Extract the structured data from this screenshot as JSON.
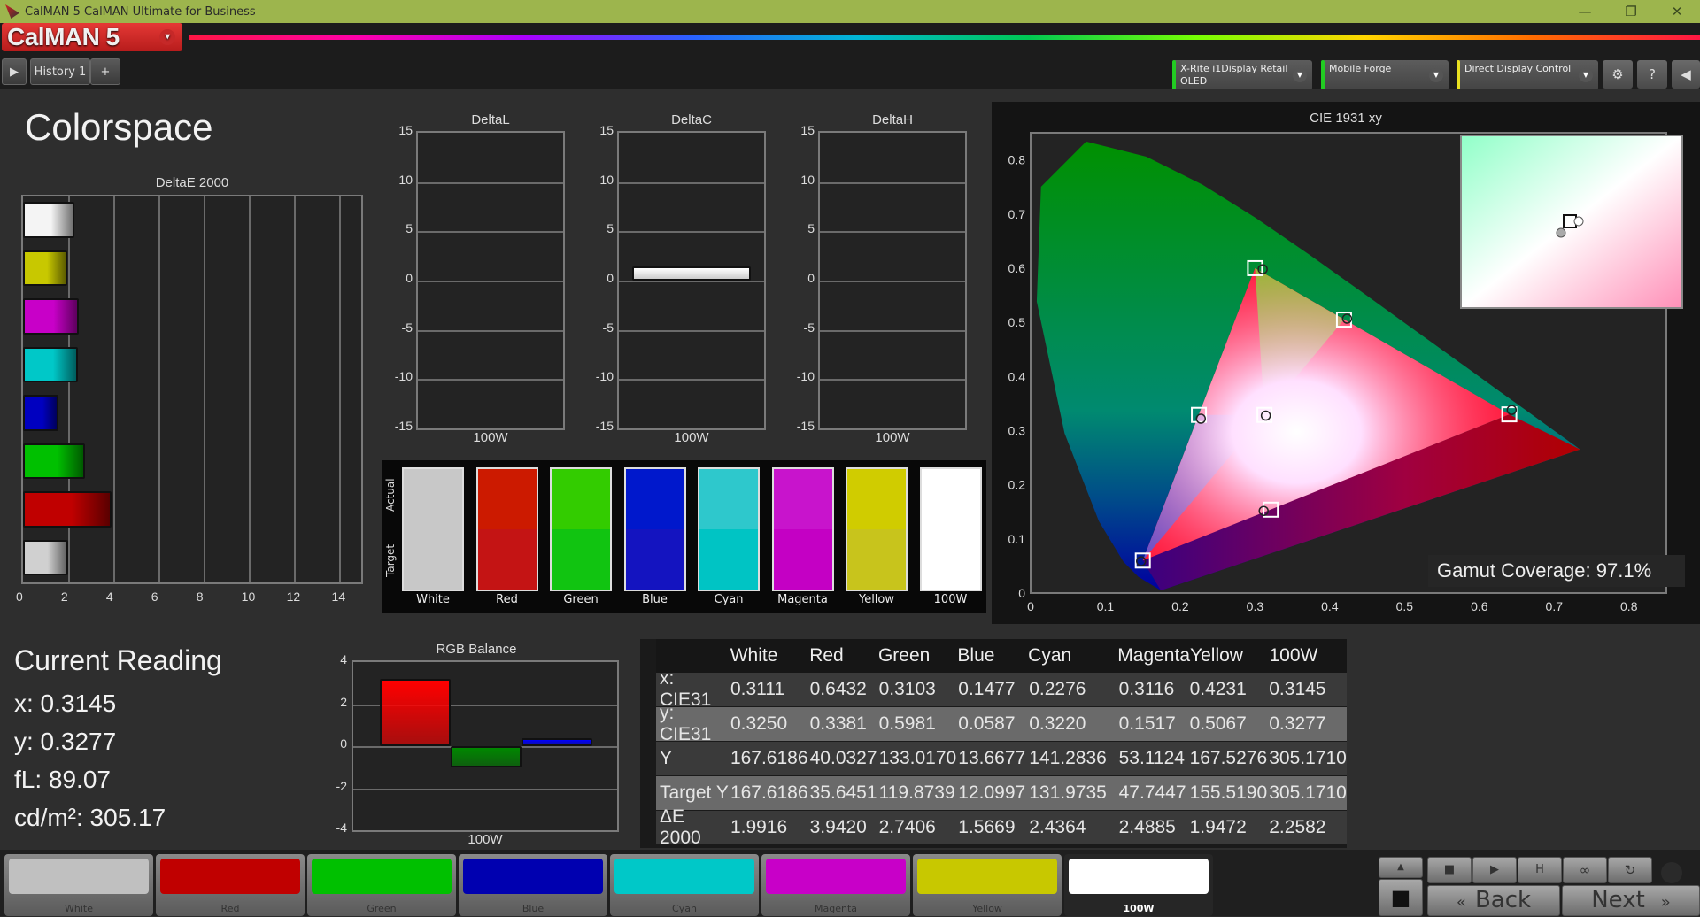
{
  "window": {
    "title": "CalMAN 5 CalMAN Ultimate for Business",
    "minimize": "—",
    "restore": "❐",
    "close": "✕"
  },
  "brand": {
    "name": "CalMAN 5",
    "dropdown": "▾"
  },
  "toolbar": {
    "play_icon": "▶",
    "history_tab": "History 1",
    "add_tab": "+",
    "devices": [
      {
        "line1": "X-Rite i1Display Retail",
        "line2": "OLED",
        "accent": "#22cc22"
      },
      {
        "line1": "Mobile Forge",
        "line2": "",
        "accent": "#22cc22"
      },
      {
        "line1": "Direct Display Control",
        "line2": "",
        "accent": "#e8e020"
      }
    ],
    "settings_icon": "⚙",
    "help_icon": "?",
    "collapse_icon": "◀"
  },
  "page": {
    "title": "Colorspace"
  },
  "deltaE_chart": {
    "title": "DeltaE 2000",
    "xlim": [
      0,
      15
    ],
    "ticks": [
      "0",
      "2",
      "4",
      "6",
      "8",
      "10",
      "12",
      "14"
    ],
    "bars": [
      {
        "name": "100W",
        "value": 2.2582,
        "color": "#f4f4f4"
      },
      {
        "name": "Yellow",
        "value": 1.9472,
        "color": "#c8c800"
      },
      {
        "name": "Magenta",
        "value": 2.4885,
        "color": "#c800c8"
      },
      {
        "name": "Cyan",
        "value": 2.4364,
        "color": "#00c8c8"
      },
      {
        "name": "Blue",
        "value": 1.5669,
        "color": "#0000c0"
      },
      {
        "name": "Green",
        "value": 2.7406,
        "color": "#00c000"
      },
      {
        "name": "Red",
        "value": 3.942,
        "color": "#c00000"
      },
      {
        "name": "White",
        "value": 1.9916,
        "color": "#d0d0d0"
      }
    ]
  },
  "delta_charts": [
    {
      "title": "DeltaL",
      "category": "100W",
      "value": 0,
      "ticks": [
        "15",
        "10",
        "5",
        "0",
        "-5",
        "-10",
        "-15"
      ]
    },
    {
      "title": "DeltaC",
      "category": "100W",
      "value": 1.4,
      "ticks": [
        "15",
        "10",
        "5",
        "0",
        "-5",
        "-10",
        "-15"
      ]
    },
    {
      "title": "DeltaH",
      "category": "100W",
      "value": 0,
      "ticks": [
        "15",
        "10",
        "5",
        "0",
        "-5",
        "-10",
        "-15"
      ]
    }
  ],
  "swatches": {
    "actual_label": "Actual",
    "target_label": "Target",
    "items": [
      {
        "name": "White",
        "actual": "#c8c8c8",
        "target": "#c8c8c8"
      },
      {
        "name": "Red",
        "actual": "#cc1a00",
        "target": "#c41414"
      },
      {
        "name": "Green",
        "actual": "#33cc00",
        "target": "#11c411"
      },
      {
        "name": "Blue",
        "actual": "#0018cc",
        "target": "#1414c0"
      },
      {
        "name": "Cyan",
        "actual": "#2ec8cc",
        "target": "#00c4c4"
      },
      {
        "name": "Magenta",
        "actual": "#c814cc",
        "target": "#c400c4"
      },
      {
        "name": "Yellow",
        "actual": "#d0cc00",
        "target": "#c8c41c"
      },
      {
        "name": "100W",
        "actual": "#ffffff",
        "target": "#ffffff"
      }
    ]
  },
  "cie": {
    "title": "CIE 1931 xy",
    "gamut_label": "Gamut Coverage:",
    "gamut_value": "97.1%",
    "x_ticks": [
      "0",
      "0.1",
      "0.2",
      "0.3",
      "0.4",
      "0.5",
      "0.6",
      "0.7",
      "0.8"
    ],
    "y_ticks": [
      "0",
      "0.1",
      "0.2",
      "0.3",
      "0.4",
      "0.5",
      "0.6",
      "0.7",
      "0.8"
    ],
    "targets": [
      [
        0.64,
        0.33
      ],
      [
        0.3,
        0.6
      ],
      [
        0.15,
        0.06
      ],
      [
        0.3127,
        0.329
      ],
      [
        0.225,
        0.329
      ],
      [
        0.321,
        0.154
      ],
      [
        0.419,
        0.505
      ]
    ],
    "measured": [
      [
        0.6432,
        0.3381
      ],
      [
        0.3103,
        0.5981
      ],
      [
        0.1477,
        0.0587
      ],
      [
        0.3145,
        0.3277
      ],
      [
        0.2276,
        0.322
      ],
      [
        0.3116,
        0.1517
      ],
      [
        0.4231,
        0.5067
      ]
    ]
  },
  "current_reading": {
    "title": "Current Reading",
    "x": "x: 0.3145",
    "y": "y: 0.3277",
    "fL": "fL: 89.07",
    "cdm2": "cd/m²: 305.17"
  },
  "rgb_balance": {
    "title": "RGB Balance",
    "category": "100W",
    "ylim": [
      -4,
      4
    ],
    "ticks": [
      "4",
      "2",
      "0",
      "-2",
      "-4"
    ],
    "bars": [
      {
        "name": "R",
        "value": 3.2,
        "color": "#ff0000"
      },
      {
        "name": "G",
        "value": -1.0,
        "color": "#008800"
      },
      {
        "name": "B",
        "value": 0.4,
        "color": "#0000ff"
      }
    ]
  },
  "table": {
    "headers": [
      "",
      "White",
      "Red",
      "Green",
      "Blue",
      "Cyan",
      "Magenta",
      "Yellow",
      "100W"
    ],
    "rows": [
      [
        "x: CIE31",
        "0.3111",
        "0.6432",
        "0.3103",
        "0.1477",
        "0.2276",
        "0.3116",
        "0.4231",
        "0.3145"
      ],
      [
        "y: CIE31",
        "0.3250",
        "0.3381",
        "0.5981",
        "0.0587",
        "0.3220",
        "0.1517",
        "0.5067",
        "0.3277"
      ],
      [
        "Y",
        "167.6186",
        "40.0327",
        "133.0170",
        "13.6677",
        "141.2836",
        "53.1124",
        "167.5276",
        "305.1710"
      ],
      [
        "Target Y",
        "167.6186",
        "35.6451",
        "119.8739",
        "12.0997",
        "131.9735",
        "47.7447",
        "155.5190",
        "305.1710"
      ],
      [
        "ΔE 2000",
        "1.9916",
        "3.9420",
        "2.7406",
        "1.5669",
        "2.4364",
        "2.4885",
        "1.9472",
        "2.2582"
      ]
    ]
  },
  "bottom_swatches": [
    {
      "name": "White",
      "color": "#c0c0c0"
    },
    {
      "name": "Red",
      "color": "#c00000"
    },
    {
      "name": "Green",
      "color": "#00c000"
    },
    {
      "name": "Blue",
      "color": "#0000b0"
    },
    {
      "name": "Cyan",
      "color": "#00c8c8"
    },
    {
      "name": "Magenta",
      "color": "#c800c8"
    },
    {
      "name": "Yellow",
      "color": "#c8c800"
    },
    {
      "name": "100W",
      "color": "#ffffff",
      "selected": true
    }
  ],
  "nav": {
    "up_icon": "▲",
    "stop_icon": "■",
    "stop_small": "■",
    "play_icon": "▶",
    "hold_icon": "H",
    "loop_icon": "∞",
    "refresh_icon": "↻",
    "back": "Back",
    "next": "Next",
    "back_icon": "«",
    "next_icon": "»"
  }
}
